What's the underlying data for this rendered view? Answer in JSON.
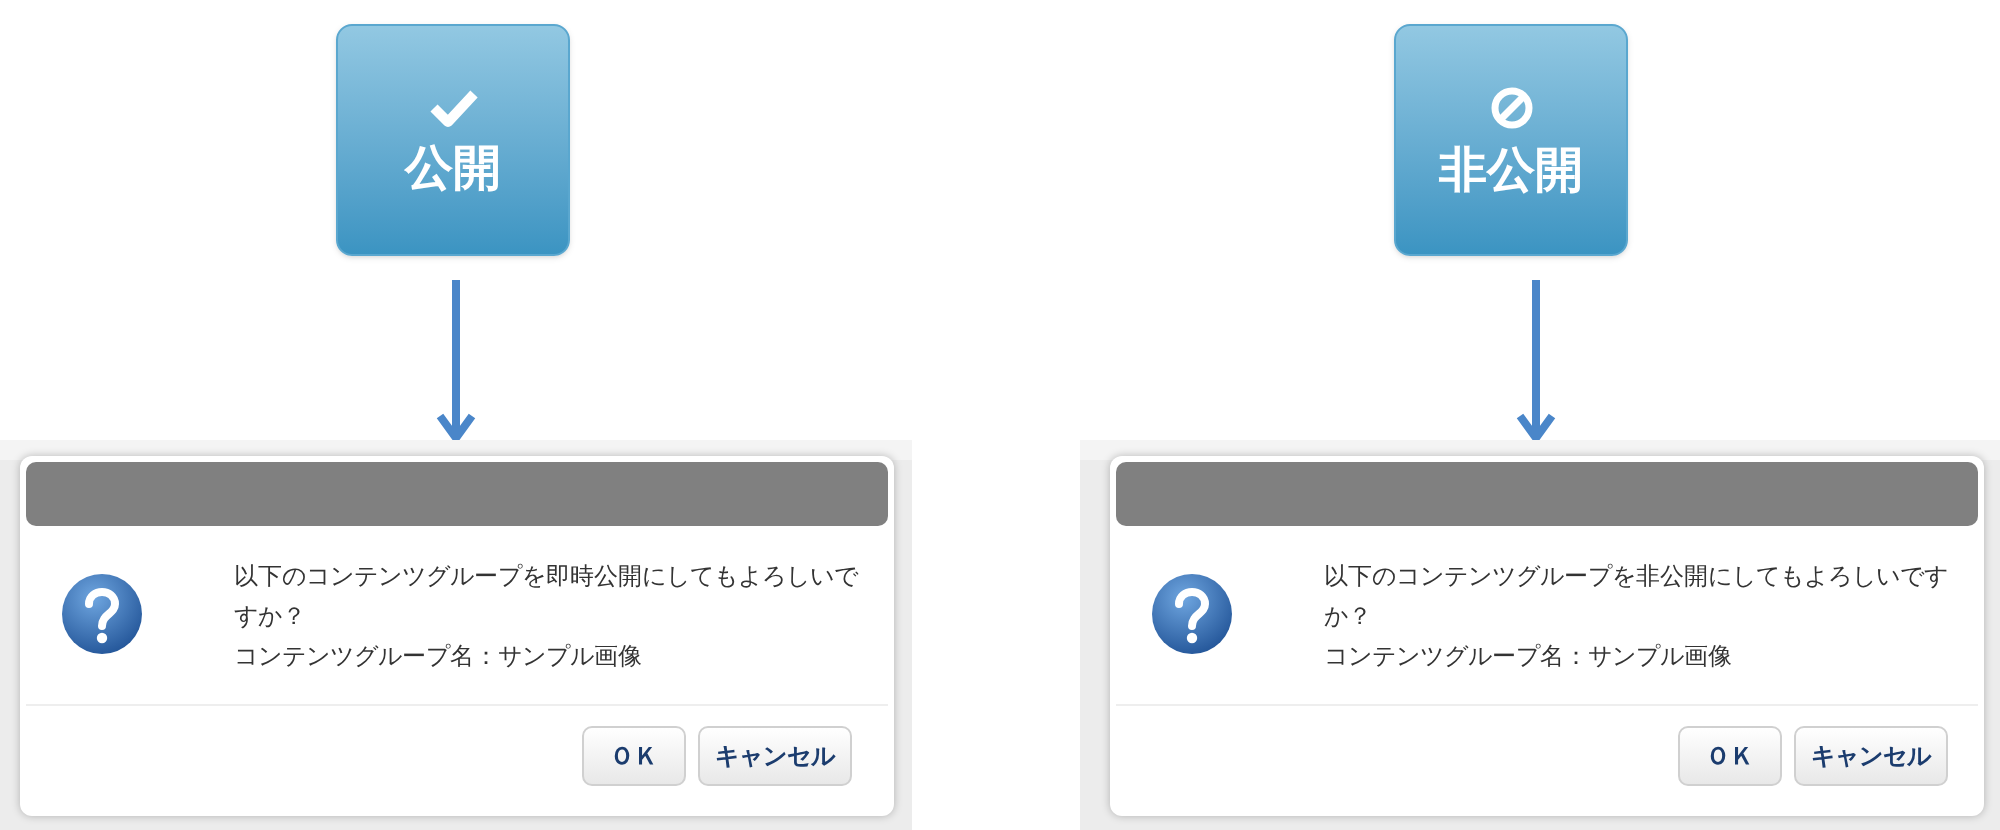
{
  "panels": [
    {
      "action_button": {
        "kind": "publish",
        "label": "公開"
      },
      "dialog": {
        "message": "以下のコンテンツグループを即時公開にしてもよろしいですか？",
        "detail": "コンテンツグループ名：サンプル画像",
        "buttons": [
          {
            "label": "ＯＫ"
          },
          {
            "label": "キャンセル"
          }
        ]
      }
    },
    {
      "action_button": {
        "kind": "unpublish",
        "label": "非公開"
      },
      "dialog": {
        "message": "以下のコンテンツグループを非公開にしてもよろしいですか？",
        "detail": "コンテンツグループ名：サンプル画像",
        "buttons": [
          {
            "label": "ＯＫ"
          },
          {
            "label": "キャンセル"
          }
        ]
      }
    }
  ]
}
